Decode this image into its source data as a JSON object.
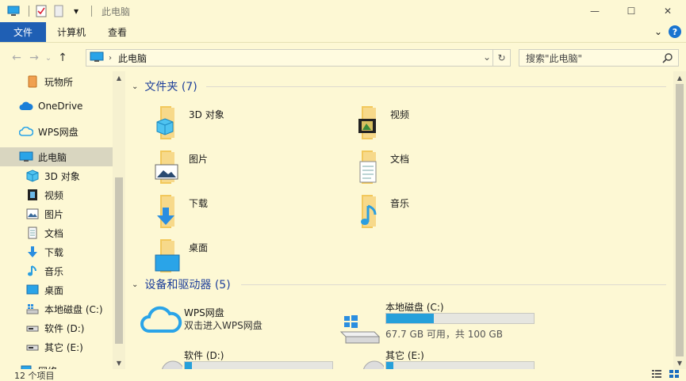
{
  "window": {
    "title": "此电脑",
    "quick_access_dropdown": "▾",
    "ctrl_minimize": "—",
    "ctrl_maximize": "☐",
    "ctrl_close": "✕"
  },
  "ribbon": {
    "tabs": [
      "文件",
      "计算机",
      "查看"
    ],
    "collapse": "⌄",
    "help": "?"
  },
  "nav": {
    "back": "←",
    "forward": "→",
    "recent": "⌄",
    "up": "↑",
    "breadcrumb_sep": "›",
    "address": "此电脑",
    "address_dropdown": "⌄",
    "refresh": "↻",
    "search_placeholder": "搜索\"此电脑\""
  },
  "sidebar": {
    "items": [
      {
        "label": "玩物所",
        "icon": "folder-orange-icon"
      },
      {
        "label": "OneDrive",
        "icon": "cloud-icon"
      },
      {
        "label": "WPS网盘",
        "icon": "wps-cloud-icon"
      },
      {
        "label": "此电脑",
        "icon": "computer-icon",
        "selected": true
      },
      {
        "label": "3D 对象",
        "icon": "cube-icon"
      },
      {
        "label": "视频",
        "icon": "film-icon"
      },
      {
        "label": "图片",
        "icon": "image-icon"
      },
      {
        "label": "文档",
        "icon": "document-icon"
      },
      {
        "label": "下载",
        "icon": "download-arrow-icon"
      },
      {
        "label": "音乐",
        "icon": "music-note-icon"
      },
      {
        "label": "桌面",
        "icon": "desktop-icon"
      },
      {
        "label": "本地磁盘 (C:)",
        "icon": "windows-drive-icon"
      },
      {
        "label": "软件 (D:)",
        "icon": "drive-icon"
      },
      {
        "label": "其它 (E:)",
        "icon": "drive-icon"
      },
      {
        "label": "网络",
        "icon": "network-icon"
      }
    ]
  },
  "content": {
    "folders_header": "文件夹 (7)",
    "folders": [
      {
        "name": "3D 对象",
        "overlay": "cube-icon"
      },
      {
        "name": "视频",
        "overlay": "film-icon"
      },
      {
        "name": "图片",
        "overlay": "image-icon"
      },
      {
        "name": "文档",
        "overlay": "document-icon"
      },
      {
        "name": "下载",
        "overlay": "download-arrow-icon"
      },
      {
        "name": "音乐",
        "overlay": "music-note-icon"
      },
      {
        "name": "桌面",
        "overlay": "desktop-icon"
      }
    ],
    "drives_header": "设备和驱动器 (5)",
    "drives": [
      {
        "name": "WPS网盘",
        "subtitle": "双击进入WPS网盘",
        "icon": "wps-cloud-icon"
      },
      {
        "name": "本地磁盘 (C:)",
        "size_text": "67.7 GB 可用，共 100 GB",
        "used_fraction": 0.323,
        "icon": "windows-drive-icon"
      },
      {
        "name": "软件 (D:)",
        "used_fraction": 0.05,
        "icon": "drive-icon"
      },
      {
        "name": "其它 (E:)",
        "used_fraction": 0.05,
        "icon": "drive-icon"
      }
    ]
  },
  "status": {
    "item_count": "12 个项目"
  },
  "colors": {
    "background": "#fdf8d4",
    "file_tab": "#1f5fb4",
    "group_header": "#1e3f9a",
    "drive_bar_fill": "#26a0da",
    "folder": "#f2c85c"
  }
}
